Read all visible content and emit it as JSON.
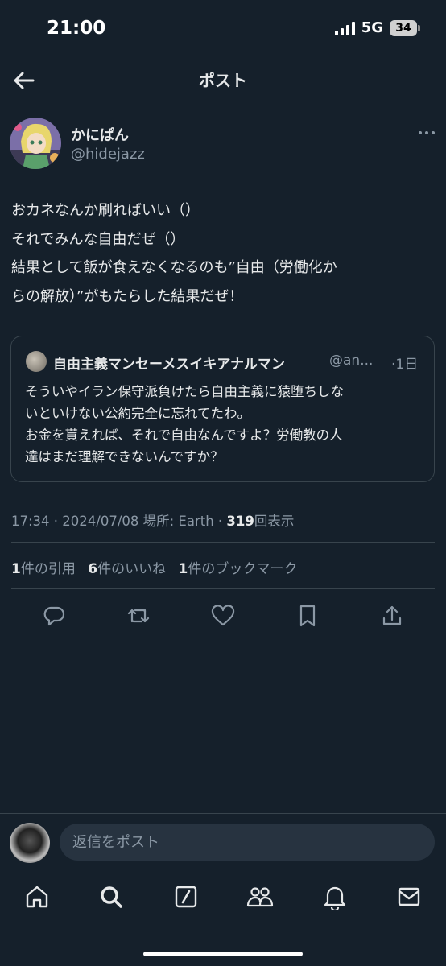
{
  "status_bar": {
    "time": "21:00",
    "network": "5G",
    "battery": "34"
  },
  "header": {
    "title": "ポスト"
  },
  "post": {
    "author_name": "かにぱん",
    "author_handle": "@hidejazz",
    "lines": [
      "おカネなんか刷ればいい（）",
      "それでみんな自由だぜ（）",
      "結果として飯が食えなくなるのも”自由（労働化か",
      "らの解放）”がもたらした結果だぜ！"
    ]
  },
  "quote": {
    "author_name": "自由主義マンセーメスイキアナルマン",
    "author_handle": "@an...",
    "separator": "·",
    "time": "1日",
    "lines": [
      "そういやイラン保守派負けたら自由主義に猿堕ちしな",
      "いといけない公約完全に忘れてたわ。",
      "お金を貰えれば、それで自由なんですよ？労働教の人",
      "達はまだ理解できないんですか？"
    ]
  },
  "meta": {
    "prefix": "17:34 · 2024/07/08 場所: Earth · ",
    "views_count": "319",
    "views_label": "回表示"
  },
  "stats": {
    "quotes_count": "1",
    "quotes_label": "件の引用",
    "likes_count": "6",
    "likes_label": "件のいいね",
    "bookmarks_count": "1",
    "bookmarks_label": "件のブックマーク"
  },
  "reply": {
    "placeholder": "返信をポスト"
  },
  "icons": {
    "back": "arrow-left-icon",
    "reply": "reply-icon",
    "retweet": "retweet-icon",
    "like": "heart-icon",
    "bookmark": "bookmark-icon",
    "share": "share-icon",
    "home": "home-icon",
    "search": "search-icon",
    "grok": "grok-icon",
    "communities": "communities-icon",
    "notifications": "bell-icon",
    "messages": "mail-icon"
  },
  "colors": {
    "background": "#15202b",
    "text": "#e7e9ea",
    "secondary": "#8b98a5",
    "border": "#38444d"
  }
}
